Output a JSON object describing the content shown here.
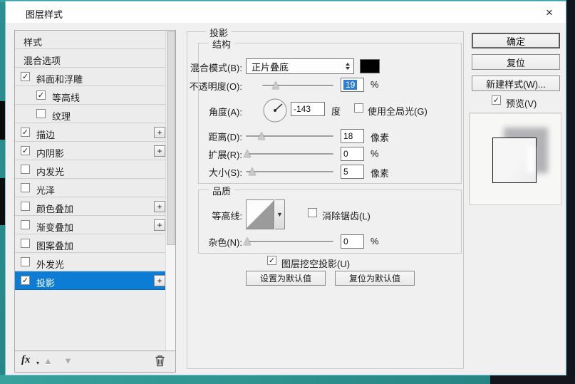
{
  "window": {
    "title": "图层样式"
  },
  "icons": {
    "close": "×",
    "check": "✓",
    "plus": "+",
    "fx": "fx",
    "fx_caret": "▾",
    "up_arrow": "▲",
    "down_arrow": "▼",
    "dropdown_arrow": "▼"
  },
  "sidebar": {
    "items": [
      {
        "label": "样式",
        "has_checkbox": false,
        "checked": false,
        "indent": false,
        "has_plus": false,
        "selected": false
      },
      {
        "label": "混合选项",
        "has_checkbox": false,
        "checked": false,
        "indent": false,
        "has_plus": false,
        "selected": false
      },
      {
        "label": "斜面和浮雕",
        "has_checkbox": true,
        "checked": true,
        "indent": false,
        "has_plus": false,
        "selected": false
      },
      {
        "label": "等高线",
        "has_checkbox": true,
        "checked": true,
        "indent": true,
        "has_plus": false,
        "selected": false
      },
      {
        "label": "纹理",
        "has_checkbox": true,
        "checked": false,
        "indent": true,
        "has_plus": false,
        "selected": false
      },
      {
        "label": "描边",
        "has_checkbox": true,
        "checked": true,
        "indent": false,
        "has_plus": true,
        "selected": false
      },
      {
        "label": "内阴影",
        "has_checkbox": true,
        "checked": true,
        "indent": false,
        "has_plus": true,
        "selected": false
      },
      {
        "label": "内发光",
        "has_checkbox": true,
        "checked": false,
        "indent": false,
        "has_plus": false,
        "selected": false
      },
      {
        "label": "光泽",
        "has_checkbox": true,
        "checked": false,
        "indent": false,
        "has_plus": false,
        "selected": false
      },
      {
        "label": "颜色叠加",
        "has_checkbox": true,
        "checked": false,
        "indent": false,
        "has_plus": true,
        "selected": false
      },
      {
        "label": "渐变叠加",
        "has_checkbox": true,
        "checked": false,
        "indent": false,
        "has_plus": true,
        "selected": false
      },
      {
        "label": "图案叠加",
        "has_checkbox": true,
        "checked": false,
        "indent": false,
        "has_plus": false,
        "selected": false
      },
      {
        "label": "外发光",
        "has_checkbox": true,
        "checked": false,
        "indent": false,
        "has_plus": false,
        "selected": false
      },
      {
        "label": "投影",
        "has_checkbox": true,
        "checked": true,
        "indent": false,
        "has_plus": true,
        "selected": true
      }
    ]
  },
  "panel": {
    "section_title": "投影",
    "structure": {
      "title": "结构",
      "blend_mode_label": "混合模式(B):",
      "blend_mode_value": "正片叠底",
      "swatch_color": "#000000",
      "opacity_label": "不透明度(O):",
      "opacity_value": "19",
      "opacity_unit": "%",
      "angle_label": "角度(A):",
      "angle_value": "-143",
      "angle_unit": "度",
      "global_light_label": "使用全局光(G)",
      "global_light_checked": false,
      "distance_label": "距离(D):",
      "distance_value": "18",
      "distance_unit": "像素",
      "spread_label": "扩展(R):",
      "spread_value": "0",
      "spread_unit": "%",
      "size_label": "大小(S):",
      "size_value": "5",
      "size_unit": "像素"
    },
    "quality": {
      "title": "品质",
      "contour_label": "等高线:",
      "antialias_label": "消除锯齿(L)",
      "antialias_checked": false,
      "noise_label": "杂色(N):",
      "noise_value": "0",
      "noise_unit": "%"
    },
    "knockout_label": "图层挖空投影(U)",
    "knockout_checked": true,
    "make_default_label": "设置为默认值",
    "reset_default_label": "复位为默认值"
  },
  "actions": {
    "ok": "确定",
    "reset": "复位",
    "new_style": "新建样式(W)...",
    "preview_label": "预览(V)",
    "preview_checked": true
  },
  "colors": {
    "selection_blue": "#0c7cd5",
    "accent_teal": "#2c8f92",
    "value_highlight": "#2f7fd0"
  }
}
